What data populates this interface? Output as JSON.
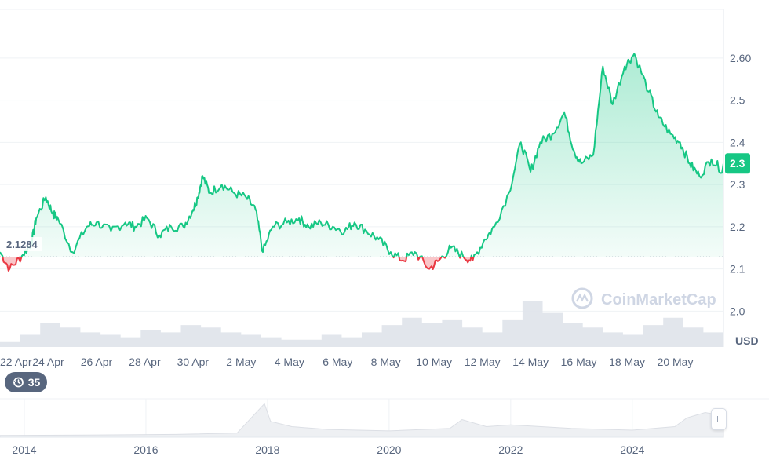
{
  "chart_data": {
    "type": "area",
    "currency": "USD",
    "price_badge": "2.3",
    "baseline_label": "2.1284",
    "baseline_value": 2.1284,
    "ylim": [
      1.915,
      2.715
    ],
    "y_ticks": [
      "2.60",
      "2.5",
      "2.4",
      "2.3",
      "2.2",
      "2.1",
      "2.0"
    ],
    "y_tick_values": [
      2.6,
      2.5,
      2.4,
      2.3,
      2.2,
      2.1,
      2.0
    ],
    "x_ticks": [
      "22 Apr",
      "24 Apr",
      "26 Apr",
      "28 Apr",
      "30 Apr",
      "2 May",
      "4 May",
      "6 May",
      "8 May",
      "10 May",
      "12 May",
      "14 May",
      "16 May",
      "18 May",
      "20 May"
    ],
    "xlim_days": [
      0,
      30
    ],
    "x_days": [
      0.0,
      0.4,
      0.9,
      1.3,
      1.5,
      1.9,
      2.2,
      2.4,
      3.0,
      3.6,
      4.0,
      4.6,
      5.2,
      5.6,
      6.1,
      6.6,
      7.1,
      7.6,
      8.0,
      8.2,
      8.4,
      8.7,
      9.2,
      9.7,
      10.2,
      10.6,
      10.9,
      11.3,
      11.9,
      12.4,
      12.8,
      13.3,
      13.8,
      14.3,
      14.7,
      15.2,
      15.7,
      16.2,
      16.7,
      17.2,
      17.8,
      18.2,
      18.7,
      19.2,
      19.6,
      20.1,
      20.5,
      21.1,
      21.6,
      22.0,
      22.4,
      22.9,
      23.4,
      23.8,
      24.1,
      24.6,
      25.0,
      25.4,
      25.9,
      26.3,
      26.9,
      27.3,
      27.8,
      28.2,
      28.6,
      29.0,
      29.5,
      30.0
    ],
    "values": [
      2.14,
      2.1,
      2.13,
      2.16,
      2.22,
      2.27,
      2.23,
      2.22,
      2.14,
      2.2,
      2.21,
      2.19,
      2.21,
      2.2,
      2.22,
      2.18,
      2.2,
      2.2,
      2.24,
      2.27,
      2.32,
      2.28,
      2.3,
      2.28,
      2.27,
      2.24,
      2.14,
      2.2,
      2.21,
      2.22,
      2.2,
      2.21,
      2.2,
      2.19,
      2.21,
      2.19,
      2.17,
      2.14,
      2.12,
      2.14,
      2.1,
      2.12,
      2.15,
      2.13,
      2.12,
      2.17,
      2.2,
      2.28,
      2.4,
      2.33,
      2.4,
      2.42,
      2.47,
      2.38,
      2.35,
      2.37,
      2.58,
      2.49,
      2.58,
      2.61,
      2.52,
      2.46,
      2.42,
      2.4,
      2.35,
      2.32,
      2.36,
      2.33,
      2.29,
      2.37,
      2.42,
      2.32,
      2.36,
      2.32,
      2.35
    ],
    "volume_relative": [
      0.1,
      0.25,
      0.5,
      0.4,
      0.3,
      0.25,
      0.2,
      0.35,
      0.3,
      0.45,
      0.4,
      0.3,
      0.25,
      0.2,
      0.15,
      0.15,
      0.25,
      0.2,
      0.3,
      0.45,
      0.6,
      0.5,
      0.55,
      0.4,
      0.3,
      0.55,
      0.95,
      0.7,
      0.5,
      0.4,
      0.3,
      0.25,
      0.45,
      0.6,
      0.4,
      0.3
    ],
    "navigator": {
      "x_ticks": [
        "2014",
        "2016",
        "2018",
        "2020",
        "2022",
        "2024"
      ],
      "x_tick_years": [
        2014,
        2016,
        2018,
        2020,
        2022,
        2024
      ],
      "xlim_years": [
        2013.6,
        2025.5
      ],
      "years": [
        2013.6,
        2015.0,
        2016.5,
        2017.5,
        2017.95,
        2018.05,
        2018.4,
        2019.0,
        2020.0,
        2021.0,
        2021.2,
        2021.6,
        2022.0,
        2023.0,
        2024.0,
        2024.7,
        2024.9,
        2025.2,
        2025.5
      ],
      "values": [
        0.05,
        0.06,
        0.08,
        0.12,
        0.95,
        0.45,
        0.3,
        0.22,
        0.18,
        0.25,
        0.5,
        0.3,
        0.35,
        0.25,
        0.2,
        0.3,
        0.55,
        0.7,
        0.6
      ]
    },
    "events_count": "35",
    "watermark": "CoinMarketCap",
    "colors": {
      "up": "#16c784",
      "down": "#ea3943",
      "badge": "#16c784",
      "volume": "#dfe3ea",
      "grid": "#eff2f5",
      "navigator_fill": "#eef0f3",
      "events_pill": "#58667e"
    }
  }
}
